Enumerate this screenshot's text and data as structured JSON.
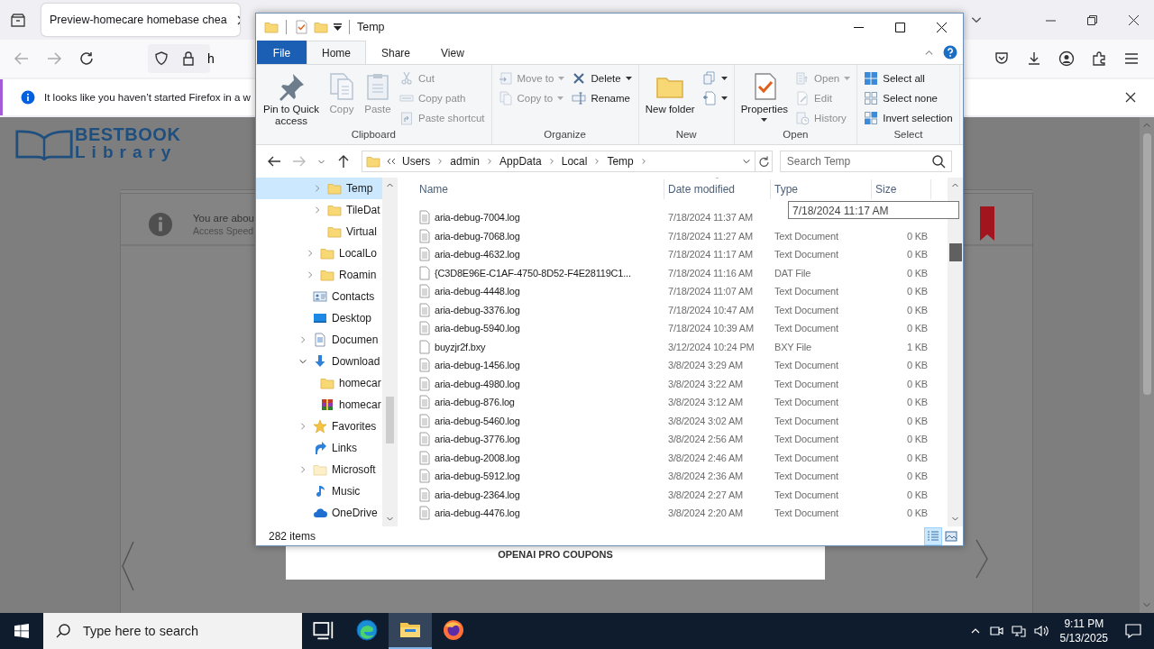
{
  "browser": {
    "tab": {
      "title": "Preview-homecare homebase chea"
    },
    "address": {
      "value": "h"
    },
    "notification": {
      "text": "It looks like you haven’t started Firefox in a w"
    }
  },
  "page": {
    "logo": {
      "line_1": "BESTBOOK",
      "line_2": "Library"
    },
    "notice": {
      "title": "You are abou",
      "subtitle": "Access Speed"
    },
    "coupon_title": "OPENAI PRO COUPONS"
  },
  "explorer": {
    "title": "Temp",
    "ribbon_tabs": [
      {
        "label": "File",
        "kind": "file",
        "selected": false
      },
      {
        "label": "Home",
        "kind": "tab",
        "selected": true
      },
      {
        "label": "Share",
        "kind": "tab",
        "selected": false
      },
      {
        "label": "View",
        "kind": "tab",
        "selected": false
      }
    ],
    "ribbon_groups": [
      {
        "label": "Clipboard",
        "columns": [
          [
            {
              "kind": "pin",
              "label": "Pin to Quick access",
              "disabled": false,
              "dropdown": false
            }
          ],
          [
            {
              "kind": "copy",
              "label": "Copy",
              "disabled": true,
              "dropdown": false
            }
          ],
          [
            {
              "kind": "paste",
              "label": "Paste",
              "disabled": true,
              "dropdown": false
            }
          ],
          [
            {
              "kind": "cut",
              "label": "Cut",
              "disabled": true,
              "dropdown": false
            },
            {
              "kind": "copypath",
              "label": "Copy path",
              "disabled": true,
              "dropdown": false
            },
            {
              "kind": "pasteshortcut",
              "label": "Paste shortcut",
              "disabled": true,
              "dropdown": false
            }
          ]
        ]
      },
      {
        "label": "Organize",
        "columns": [
          [
            {
              "kind": "moveto",
              "label": "Move to",
              "disabled": true,
              "dropdown": true
            },
            {
              "kind": "copyto",
              "label": "Copy to",
              "disabled": true,
              "dropdown": true
            }
          ],
          [
            {
              "kind": "delete",
              "label": "Delete",
              "disabled": false,
              "dropdown": true
            },
            {
              "kind": "rename",
              "label": "Rename",
              "disabled": false,
              "dropdown": false
            }
          ]
        ]
      },
      {
        "label": "New",
        "columns": [
          [
            {
              "kind": "newfolder",
              "label": "New folder",
              "disabled": false,
              "dropdown": false
            }
          ],
          [
            {
              "kind": "newitem",
              "disabled": false,
              "dropdown": true
            },
            {
              "kind": "easyaccess",
              "disabled": false,
              "dropdown": true
            }
          ]
        ]
      },
      {
        "label": "Open",
        "columns": [
          [
            {
              "kind": "properties",
              "label": "Properties",
              "disabled": false,
              "dropdown": true
            }
          ],
          [
            {
              "kind": "open",
              "label": "Open",
              "disabled": true,
              "dropdown": true
            },
            {
              "kind": "edit",
              "label": "Edit",
              "disabled": true,
              "dropdown": false
            },
            {
              "kind": "history",
              "label": "History",
              "disabled": true,
              "dropdown": false
            }
          ]
        ]
      },
      {
        "label": "Select",
        "columns": [
          [
            {
              "kind": "selectall",
              "label": "Select all",
              "disabled": false,
              "dropdown": false
            },
            {
              "kind": "selectnone",
              "label": "Select none",
              "disabled": false,
              "dropdown": false
            },
            {
              "kind": "invert",
              "label": "Invert selection",
              "disabled": false,
              "dropdown": false
            }
          ]
        ]
      }
    ],
    "address_path": [
      "Users",
      "admin",
      "AppData",
      "Local",
      "Temp"
    ],
    "search": {
      "placeholder": "Search Temp"
    },
    "nav_tree": [
      {
        "children": [
          {
            "children": [
              {
                "label": "Temp",
                "kind": "folder",
                "expandable": true,
                "expanded": false,
                "selected": true
              },
              {
                "label": "TileDat",
                "kind": "folder",
                "expandable": true,
                "expanded": false,
                "selected": false
              },
              {
                "label": "Virtual",
                "kind": "folder",
                "expandable": false,
                "selected": false
              }
            ]
          },
          {
            "label": "LocalLo",
            "kind": "folder",
            "expandable": true,
            "expanded": false,
            "selected": false
          },
          {
            "label": "Roamin",
            "kind": "folder",
            "expandable": true,
            "expanded": false,
            "selected": false
          }
        ]
      },
      {
        "label": "Contacts",
        "kind": "contacts",
        "expandable": false,
        "selected": false
      },
      {
        "label": "Desktop",
        "kind": "desktop",
        "expandable": false,
        "selected": false
      },
      {
        "label": "Documen",
        "kind": "documents",
        "expandable": true,
        "expanded": false,
        "selected": false
      },
      {
        "label": "Download",
        "kind": "downloads",
        "expandable": true,
        "expanded": true,
        "selected": false,
        "children": [
          {
            "label": "homecar",
            "kind": "folder",
            "expandable": false,
            "selected": false
          },
          {
            "label": "homecar",
            "kind": "archive",
            "expandable": false,
            "selected": false
          }
        ]
      },
      {
        "label": "Favorites",
        "kind": "favorites",
        "expandable": true,
        "expanded": false,
        "selected": false
      },
      {
        "label": "Links",
        "kind": "links",
        "expandable": false,
        "selected": false
      },
      {
        "label": "Microsoft",
        "kind": "folderlight",
        "expandable": true,
        "expanded": false,
        "selected": false
      },
      {
        "label": "Music",
        "kind": "music",
        "expandable": false,
        "selected": false
      },
      {
        "label": "OneDrive",
        "kind": "onedrive",
        "expandable": false,
        "selected": false
      }
    ],
    "columns": [
      {
        "label": "Name",
        "sorted": false
      },
      {
        "label": "Date modified",
        "sorted": true
      },
      {
        "label": "Type",
        "sorted": false
      },
      {
        "label": "Size",
        "sorted": false
      }
    ],
    "rows": [
      {
        "kind": "text",
        "name": "aria-debug-7004.log",
        "date": "7/18/2024 11:37 AM"
      },
      {
        "kind": "text",
        "name": "aria-debug-7068.log",
        "date": "7/18/2024 11:27 AM",
        "type": "Text Document",
        "size": "0 KB"
      },
      {
        "kind": "text",
        "name": "aria-debug-4632.log",
        "date": "7/18/2024 11:17 AM",
        "type": "Text Document",
        "size": "0 KB"
      },
      {
        "kind": "blank",
        "name": "{C3D8E96E-C1AF-4750-8D52-F4E28119C1...",
        "date": "7/18/2024 11:16 AM",
        "type": "DAT File",
        "size": "0 KB"
      },
      {
        "kind": "text",
        "name": "aria-debug-4448.log",
        "date": "7/18/2024 11:07 AM",
        "type": "Text Document",
        "size": "0 KB"
      },
      {
        "kind": "text",
        "name": "aria-debug-3376.log",
        "date": "7/18/2024 10:47 AM",
        "type": "Text Document",
        "size": "0 KB"
      },
      {
        "kind": "text",
        "name": "aria-debug-5940.log",
        "date": "7/18/2024 10:39 AM",
        "type": "Text Document",
        "size": "0 KB"
      },
      {
        "kind": "blank",
        "name": "buyzjr2f.bxy",
        "date": "3/12/2024 10:24 PM",
        "type": "BXY File",
        "size": "1 KB"
      },
      {
        "kind": "text",
        "name": "aria-debug-1456.log",
        "date": "3/8/2024 3:29 AM",
        "type": "Text Document",
        "size": "0 KB"
      },
      {
        "kind": "text",
        "name": "aria-debug-4980.log",
        "date": "3/8/2024 3:22 AM",
        "type": "Text Document",
        "size": "0 KB"
      },
      {
        "kind": "text",
        "name": "aria-debug-876.log",
        "date": "3/8/2024 3:12 AM",
        "type": "Text Document",
        "size": "0 KB"
      },
      {
        "kind": "text",
        "name": "aria-debug-5460.log",
        "date": "3/8/2024 3:02 AM",
        "type": "Text Document",
        "size": "0 KB"
      },
      {
        "kind": "text",
        "name": "aria-debug-3776.log",
        "date": "3/8/2024 2:56 AM",
        "type": "Text Document",
        "size": "0 KB"
      },
      {
        "kind": "text",
        "name": "aria-debug-2008.log",
        "date": "3/8/2024 2:46 AM",
        "type": "Text Document",
        "size": "0 KB"
      },
      {
        "kind": "text",
        "name": "aria-debug-5912.log",
        "date": "3/8/2024 2:36 AM",
        "type": "Text Document",
        "size": "0 KB"
      },
      {
        "kind": "text",
        "name": "aria-debug-2364.log",
        "date": "3/8/2024 2:27 AM",
        "type": "Text Document",
        "size": "0 KB"
      },
      {
        "kind": "text",
        "name": "aria-debug-4476.log",
        "date": "3/8/2024 2:20 AM",
        "type": "Text Document",
        "size": "0 KB"
      }
    ],
    "tooltip": "7/18/2024 11:17 AM",
    "status": "282 items",
    "views": [
      {
        "selected": true
      },
      {
        "selected": false
      }
    ]
  },
  "taskbar": {
    "search": {
      "placeholder": "Type here to search"
    },
    "apps": [
      {
        "active": false
      },
      {
        "active": false
      },
      {
        "active": true
      },
      {
        "active": false
      }
    ],
    "time": "9:11 PM",
    "date": "5/13/2025"
  }
}
